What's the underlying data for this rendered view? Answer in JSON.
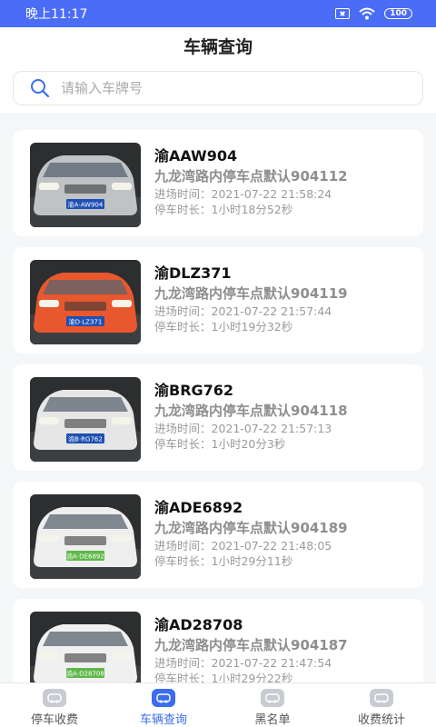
{
  "status_bar": {
    "time": "晚上11:17",
    "battery": "100"
  },
  "header": {
    "title": "车辆查询"
  },
  "search": {
    "placeholder": "请输入车牌号",
    "value": ""
  },
  "records": [
    {
      "plate": "渝AAW904",
      "location": "九龙湾路内停车点默认904112",
      "entry": "进场时间：2021-07-22 21:58:24",
      "duration": "停车时长：1小时18分52秒",
      "car_color": "#bfc3c6",
      "plate_text": "渝A·AW904",
      "plate_color": "#1f4fb3"
    },
    {
      "plate": "渝DLZ371",
      "location": "九龙湾路内停车点默认904119",
      "entry": "进场时间：2021-07-22 21:57:44",
      "duration": "停车时长：1小时19分32秒",
      "car_color": "#e8572e",
      "plate_text": "渝D·LZ371",
      "plate_color": "#1f4fb3"
    },
    {
      "plate": "渝BRG762",
      "location": "九龙湾路内停车点默认904118",
      "entry": "进场时间：2021-07-22 21:57:13",
      "duration": "停车时长：1小时20分3秒",
      "car_color": "#e6e6e6",
      "plate_text": "渝B·RG762",
      "plate_color": "#1f4fb3"
    },
    {
      "plate": "渝ADE6892",
      "location": "九龙湾路内停车点默认904189",
      "entry": "进场时间：2021-07-22 21:48:05",
      "duration": "停车时长：1小时29分11秒",
      "car_color": "#eeeeee",
      "plate_text": "渝A·DE6892",
      "plate_color": "#5fb84a"
    },
    {
      "plate": "渝AD28708",
      "location": "九龙湾路内停车点默认904187",
      "entry": "进场时间：2021-07-22 21:47:54",
      "duration": "停车时长：1小时29分22秒",
      "car_color": "#f0f0f0",
      "plate_text": "渝A·D28708",
      "plate_color": "#5fb84a"
    }
  ],
  "tabs": [
    {
      "label": "停车收费",
      "icon": "parking-fee-icon",
      "active": false
    },
    {
      "label": "车辆查询",
      "icon": "car-search-icon",
      "active": true
    },
    {
      "label": "黑名单",
      "icon": "blacklist-icon",
      "active": false
    },
    {
      "label": "收费统计",
      "icon": "statistics-icon",
      "active": false
    }
  ],
  "colors": {
    "accent": "#3a6df0",
    "status_bar": "#4a6cf7"
  }
}
